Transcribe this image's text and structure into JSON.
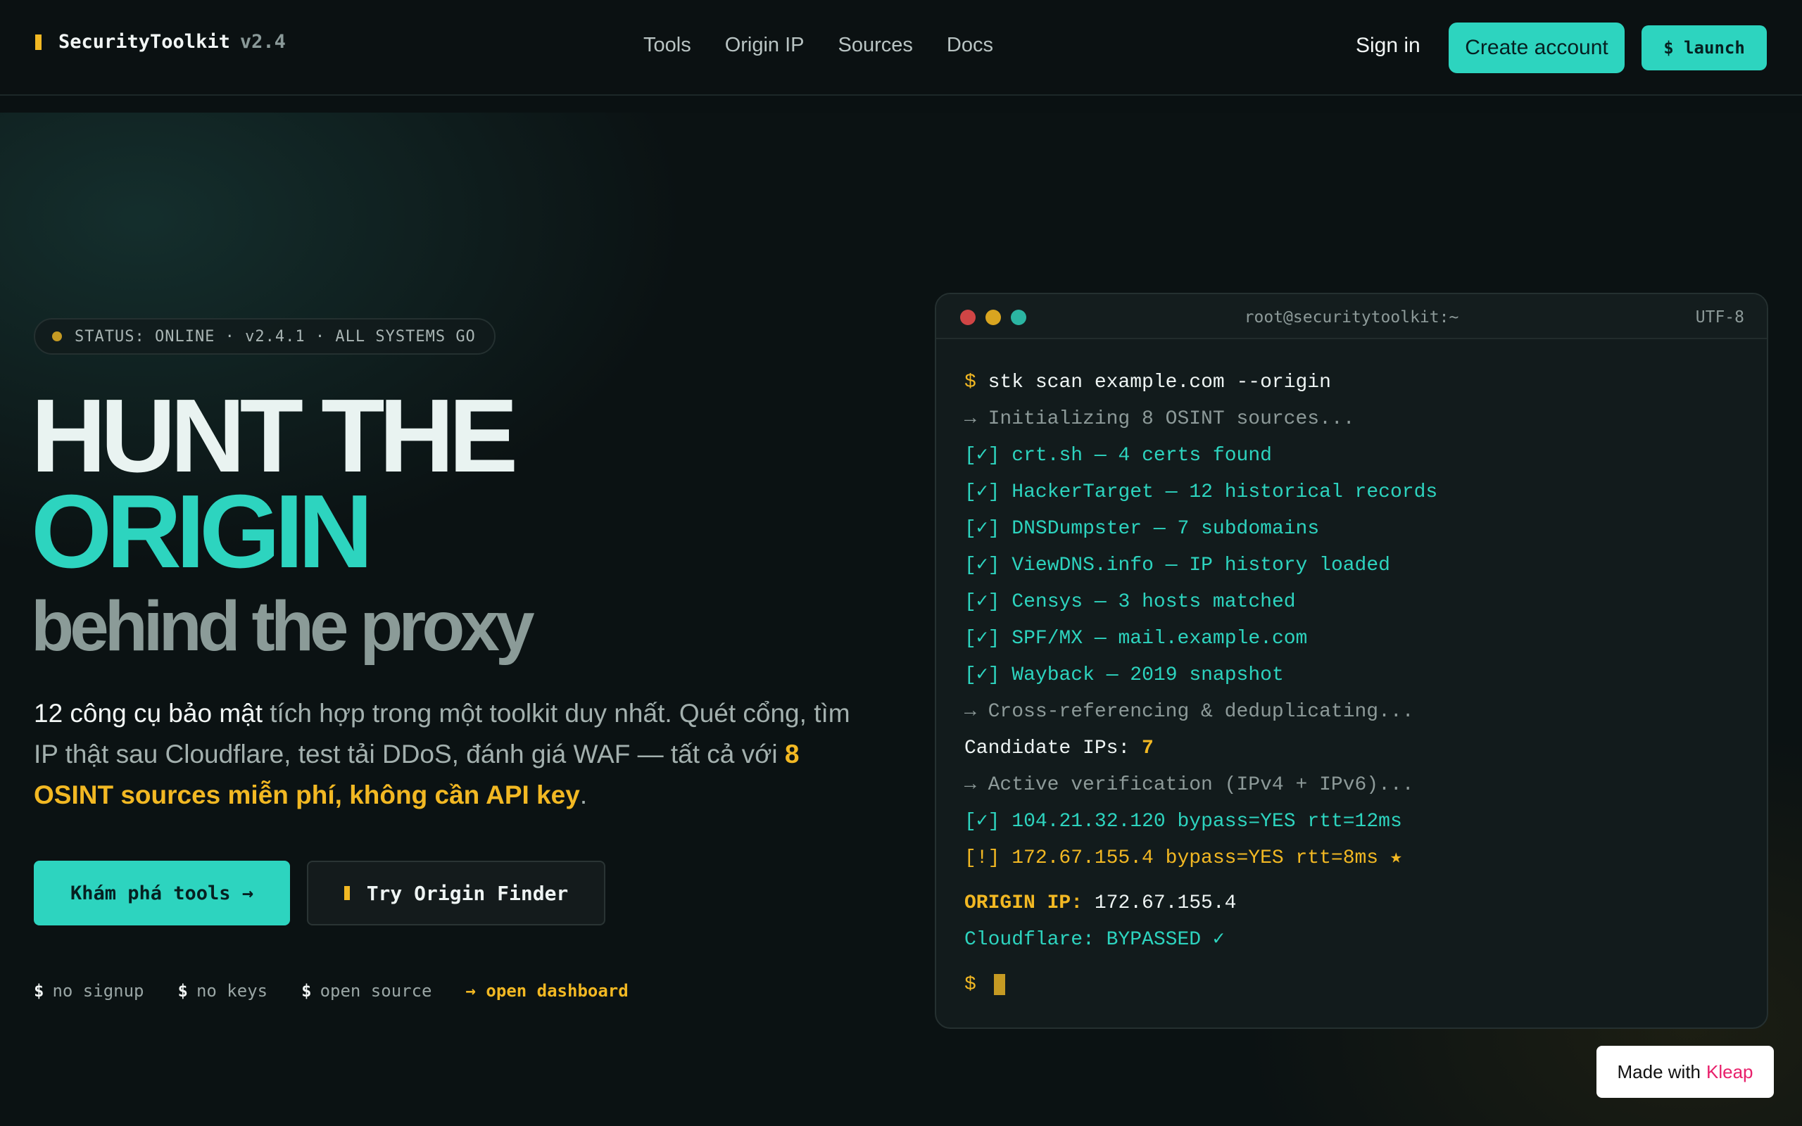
{
  "nav": {
    "brand": "SecurityToolkit",
    "version": "v2.4",
    "links": [
      "Tools",
      "Origin IP",
      "Sources",
      "Docs"
    ],
    "sign_in": "Sign in",
    "create_account": "Create account",
    "launch": "$ launch"
  },
  "hero": {
    "status": "STATUS: ONLINE · v2.4.1 · ALL SYSTEMS GO",
    "headline_1": "HUNT THE",
    "headline_2": "ORIGIN",
    "headline_3": "behind the proxy",
    "desc_strong": "12 công cụ bảo mật",
    "desc_body": " tích hợp trong một toolkit duy nhất. Quét cổng, tìm IP thật sau Cloudflare, test tải DDoS, đánh giá WAF — tất cả với ",
    "desc_highlight": "8 OSINT sources miễn phí, không cần API key",
    "desc_end": ".",
    "btn_explore": "Khám phá tools →",
    "btn_origin": "Try Origin Finder",
    "tags": [
      "no signup",
      "no keys",
      "open source"
    ],
    "tag_prefix": "$",
    "dashboard_link": "→ open dashboard"
  },
  "terminal": {
    "title": "root@securitytoolkit:~",
    "encoding": "UTF-8",
    "prompt": "$",
    "command": "stk scan example.com --origin",
    "init": "→ Initializing 8 OSINT sources...",
    "check_prefix": "[✓]",
    "sources": [
      "crt.sh — 4 certs found",
      "HackerTarget — 12 historical records",
      "DNSDumpster — 7 subdomains",
      "ViewDNS.info — IP history loaded",
      "Censys — 3 hosts matched",
      "SPF/MX — mail.example.com",
      "Wayback — 2019 snapshot"
    ],
    "cross_ref": "→ Cross-referencing & deduplicating...",
    "candidate_label": "Candidate IPs: ",
    "candidate_count": "7",
    "active_verif": "→ Active verification (IPv4 + IPv6)...",
    "verify_ok": "[✓] 104.21.32.120 bypass=YES rtt=12ms",
    "verify_warn": "[!] 172.67.155.4 bypass=YES rtt=8ms ★",
    "origin_label": "ORIGIN IP:",
    "origin_value": " 172.67.155.4",
    "cloudflare": "Cloudflare: BYPASSED ✓",
    "dot_colors": [
      "#d04545",
      "#d9a520",
      "#2bb5a2"
    ]
  },
  "badge": {
    "made_with": "Made with",
    "brand": "Kleap"
  }
}
